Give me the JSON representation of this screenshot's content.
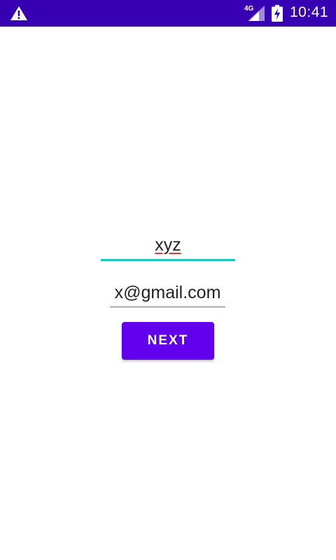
{
  "status_bar": {
    "network": "4G",
    "time": "10:41",
    "icons": [
      "warning-icon",
      "signal-icon",
      "battery-charging-icon"
    ]
  },
  "form": {
    "name_value": "xyz",
    "email_value": "x@gmail.com",
    "next_label": "NEXT"
  },
  "colors": {
    "status_bar": "#3700b3",
    "primary": "#6200ee",
    "focus_underline": "#1fc7c1"
  }
}
